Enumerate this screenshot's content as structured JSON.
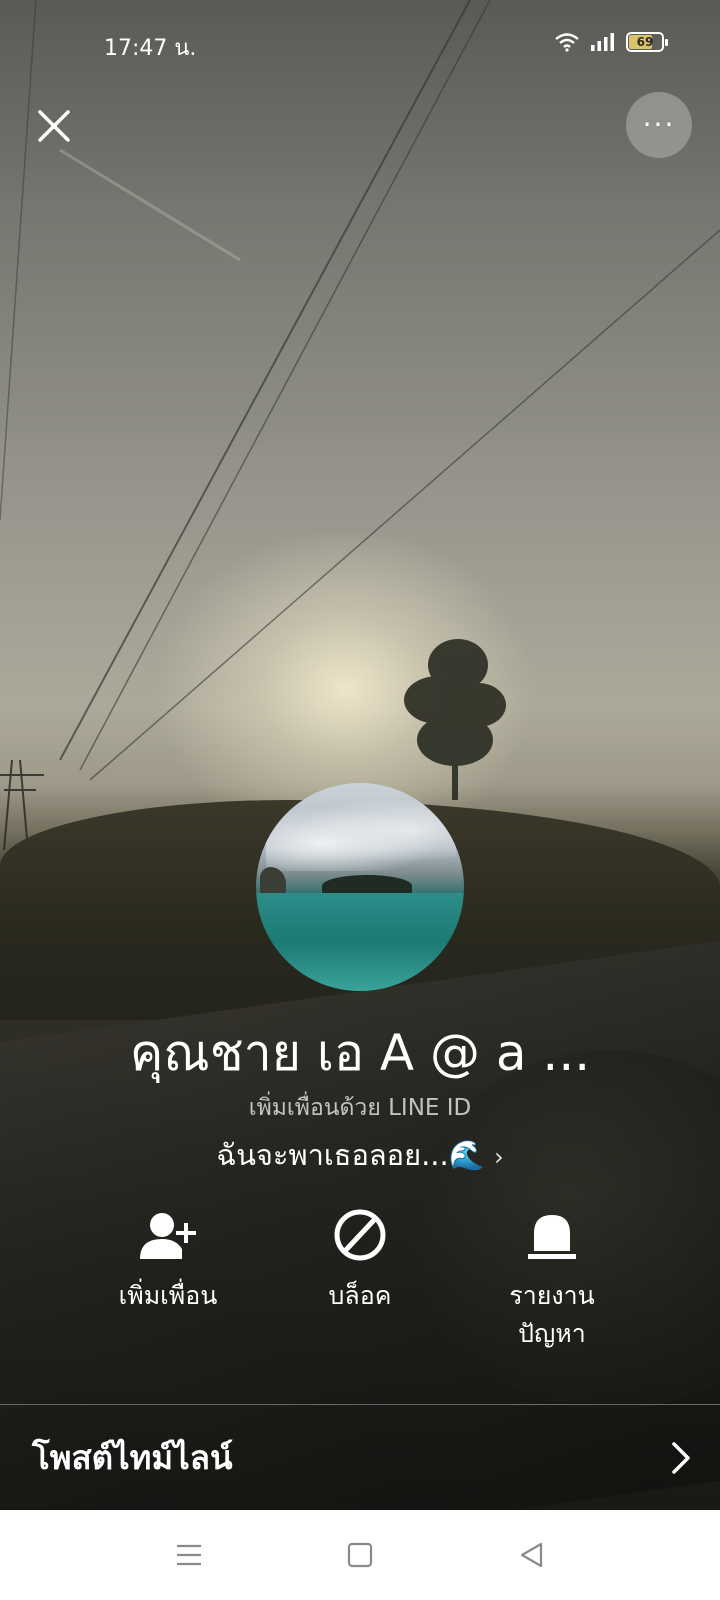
{
  "status_bar": {
    "time": "17:47 น.",
    "battery": "69",
    "battery_level": 0.69,
    "icons": [
      "wifi-icon",
      "signal-icon",
      "battery-icon"
    ]
  },
  "header": {
    "close_icon": "close-icon",
    "more_label": "···"
  },
  "profile": {
    "name": "คุณชาย เอ A @ a ...",
    "line_id_label": "เพิ่มเพื่อนด้วย LINE ID",
    "status_message": "ฉันจะพาเธอลอย...🌊",
    "status_chevron": "›"
  },
  "actions": [
    {
      "label": "เพิ่มเพื่อน",
      "icon": "add-friend-icon"
    },
    {
      "label": "บล็อค",
      "icon": "block-icon"
    },
    {
      "label": "รายงาน\nปัญหา",
      "icon": "report-icon"
    }
  ],
  "timeline": {
    "label": "โพสต์ไทม์ไลน์",
    "icon": "chevron-right-icon"
  },
  "navbar": {
    "icons": [
      "menu-icon",
      "home-square-icon",
      "back-triangle-icon"
    ]
  },
  "colors": {
    "text": "#ffffff",
    "navbar_bg": "#ffffff",
    "navbar_icons": "#8a8a8a",
    "battery_fill": "#d8c46a"
  }
}
